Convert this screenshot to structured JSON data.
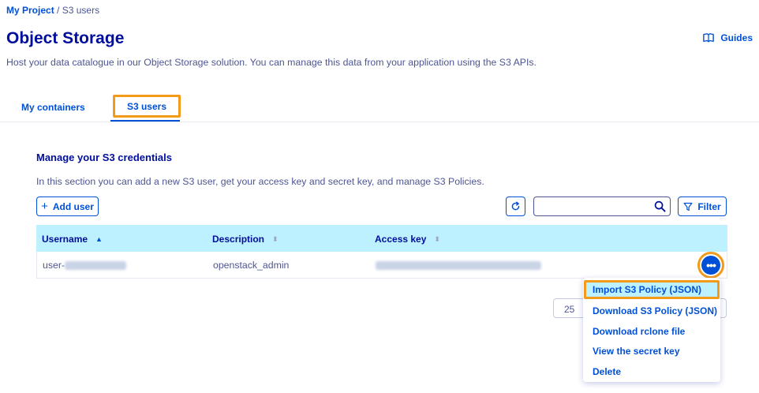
{
  "breadcrumb": {
    "project": "My Project",
    "separator": "/",
    "current": "S3 users"
  },
  "header": {
    "title": "Object Storage",
    "guides_label": "Guides",
    "guides_icon": "book-icon"
  },
  "intro": "Host your data catalogue in our Object Storage solution. You can manage this data from your application using the S3 APIs.",
  "tabs": [
    {
      "label": "My containers",
      "active": false
    },
    {
      "label": "S3 users",
      "active": true
    }
  ],
  "section": {
    "title": "Manage your S3 credentials",
    "description": "In this section you can add a new S3 user, get your access key and secret key, and manage S3 Policies."
  },
  "toolbar": {
    "add_user_label": "Add user",
    "filter_label": "Filter",
    "search_placeholder": "",
    "refresh_icon": "refresh-icon"
  },
  "table": {
    "columns": [
      "Username",
      "Description",
      "Access key"
    ],
    "rows": [
      {
        "username_prefix": "user-",
        "description": "openstack_admin"
      }
    ]
  },
  "pagination": {
    "page_size": "25"
  },
  "action_menu": {
    "items": [
      "Import S3 Policy (JSON)",
      "Download S3 Policy (JSON)",
      "Download rclone file",
      "View the secret key",
      "Delete"
    ]
  },
  "colors": {
    "primary": "#0050d7",
    "title": "#000e9c",
    "header_bg": "#bef1ff",
    "highlight": "#f49a1b",
    "text": "#4d5693"
  }
}
